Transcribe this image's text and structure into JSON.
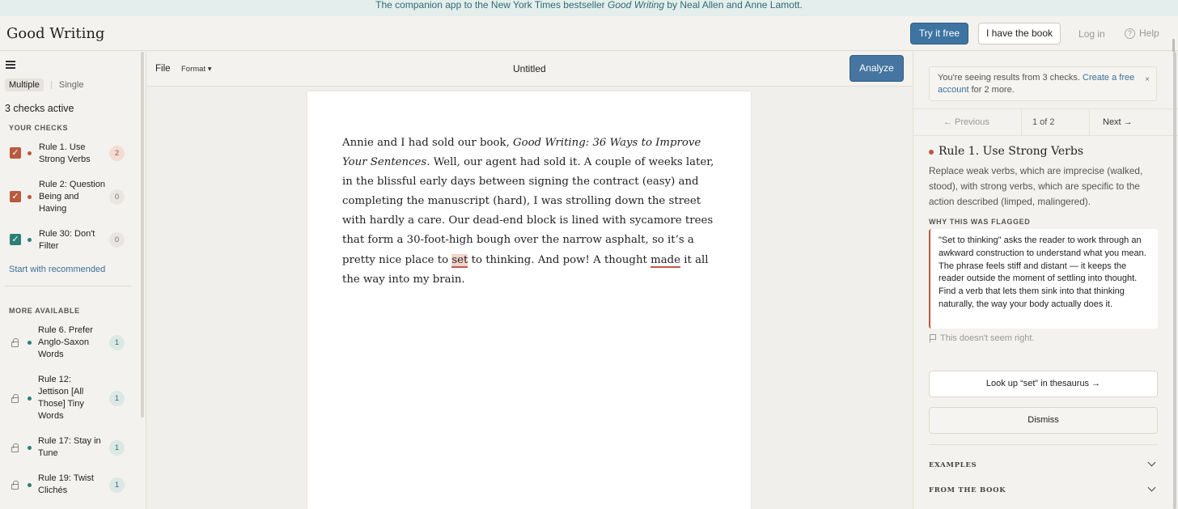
{
  "banner": {
    "prefix": "The companion app to the New York Times bestseller ",
    "book": "Good Writing",
    "suffix": " by Neal Allen and Anne Lamott."
  },
  "header": {
    "logo": "Good Writing",
    "try_label": "Try it free",
    "have_book_label": "I have the book",
    "login_label": "Log in",
    "help_label": "Help"
  },
  "sidebar": {
    "mode_multiple": "Multiple",
    "mode_single": "Single",
    "active_count": "3 checks active",
    "your_checks_heading": "YOUR CHECKS",
    "checks": [
      {
        "label": "Rule 1. Use Strong Verbs",
        "count": "2"
      },
      {
        "label": "Rule 2: Question Being and Having",
        "count": "0"
      },
      {
        "label": "Rule 30: Don't Filter",
        "count": "0"
      }
    ],
    "start_recommended": "Start with recommended",
    "more_heading": "MORE AVAILABLE",
    "more": [
      {
        "label": "Rule 6. Prefer Anglo-Saxon Words",
        "count": "1"
      },
      {
        "label": "Rule 12: Jettison [All Those] Tiny Words",
        "count": "1"
      },
      {
        "label": "Rule 17: Stay in Tune",
        "count": "1"
      },
      {
        "label": "Rule 19: Twist Clichés",
        "count": "1"
      }
    ]
  },
  "editor": {
    "file_label": "File",
    "format_label": "Format ▾",
    "doc_title": "Untitled",
    "analyze_label": "Analyze",
    "text": {
      "p1": "Annie and I had sold our book, ",
      "book_title": "Good Writing: 36 Ways to Improve Your Sentences",
      "p2": ". Well, our agent had sold it. A couple of weeks later, in the blissful early days between signing the contract (easy) and completing the manuscript (hard), I was strolling down the street with hardly a care. Our dead-end block is lined with sycamore trees that form a 30-foot-high bough over the narrow asphalt, so it’s a pretty nice place to ",
      "flag1": "set",
      "p3": " to thinking. And pow! A thought ",
      "flag2": "made",
      "p4": " it all the way into my brain."
    }
  },
  "panel": {
    "notice_text": "You're seeing results from 3 checks. ",
    "notice_link": "Create a free account",
    "notice_suffix": " for 2 more.",
    "notice_close": "×",
    "prev_label": "← Previous",
    "count_label": "1 of 2",
    "next_label": "Next →",
    "rule_title": "Rule 1. Use Strong Verbs",
    "rule_desc": "Replace weak verbs, which are imprecise (walked, stood), with strong verbs, which are specific to the action described (limped, malingered).",
    "why_heading": "WHY THIS WAS FLAGGED",
    "explanation": "\"Set to thinking\" asks the reader to work through an awkward construction to understand what you mean. The phrase feels stiff and distant — it keeps the reader outside the moment of settling into thought. Find a verb that lets them sink into that thinking naturally, the way your body actually does it.",
    "flag_label": "This doesn't seem right.",
    "lookup_label": "Look up “set” in thesaurus →",
    "dismiss_label": "Dismiss",
    "examples_label": "EXAMPLES",
    "from_book_label": "FROM THE BOOK"
  },
  "colors": {
    "accent_blue": "#3e74a2",
    "rule_red": "#b95a3e",
    "rule_teal": "#2c8078"
  }
}
